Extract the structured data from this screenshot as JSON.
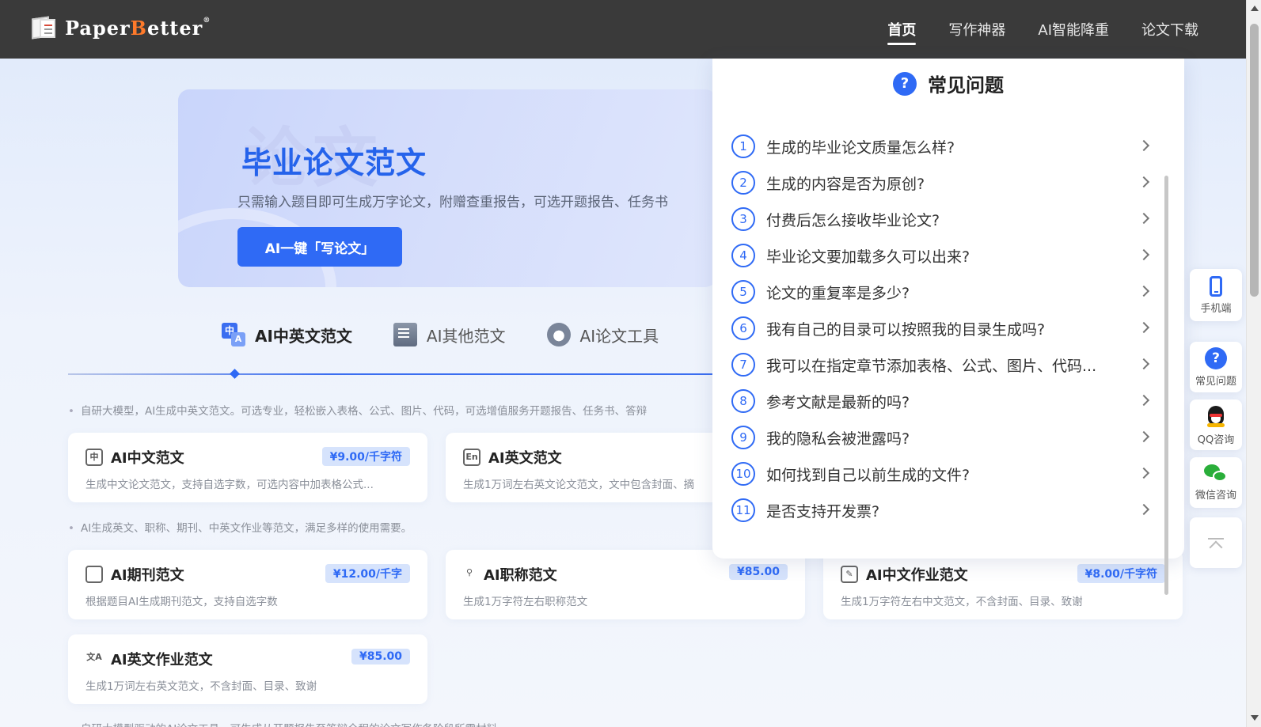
{
  "brand": {
    "logo_text_a": "Paper",
    "logo_text_b": "B",
    "logo_text_c": "etter",
    "logo_mark": "®"
  },
  "nav": [
    {
      "label": "首页",
      "active": true
    },
    {
      "label": "写作神器",
      "active": false
    },
    {
      "label": "AI智能降重",
      "active": false
    },
    {
      "label": "论文下载",
      "active": false
    }
  ],
  "banner": {
    "ghost_text": "论文",
    "title": "毕业论文范文",
    "subtitle": "只需输入题目即可生成万字论文，附赠查重报告，可选开题报告、任务书",
    "button": "AI一键「写论文」"
  },
  "tabs": [
    {
      "label": "AI中英文范文",
      "icon": "zh-en-icon",
      "active": true
    },
    {
      "label": "AI其他范文",
      "icon": "book-icon",
      "active": false
    },
    {
      "label": "AI论文工具",
      "icon": "gear-icon",
      "active": false
    }
  ],
  "notes": {
    "n1": "自研大模型，AI生成中英文范文。可选专业，轻松嵌入表格、公式、图片、代码，可选增值服务开题报告、任务书、答辩",
    "n2": "AI生成英文、职称、期刊、中英文作业等范文，满足多样的使用需要。",
    "n3": "自研大模型驱动的AI论文工具，可生成从开题报告至答辩全程的论文写作各阶段所需材料。"
  },
  "cards": {
    "zh": {
      "icon": "中",
      "title": "AI中文范文",
      "price": "¥9.00/千字符",
      "desc": "生成中文论文范文，支持自选字数，可选内容中加表格公式..."
    },
    "en": {
      "icon": "En",
      "title": "AI英文范文",
      "desc": "生成1万词左右英文论文范文，文中包含封面、摘"
    },
    "journal": {
      "icon": "journal-icon",
      "title": "AI期刊范文",
      "price": "¥12.00/千字",
      "desc": "根据题目AI生成期刊范文，支持自选字数"
    },
    "title_paper": {
      "icon": "tie-icon",
      "title": "AI职称范文",
      "price": "¥85.00",
      "desc": "生成1万字符左右职称范文"
    },
    "zh_hw": {
      "icon": "edit-doc-icon",
      "title": "AI中文作业范文",
      "price": "¥8.00/千字符",
      "desc": "生成1万字符左右中文范文，不含封面、目录、致谢"
    },
    "en_hw": {
      "icon": "translate-icon",
      "title": "AI英文作业范文",
      "price": "¥85.00",
      "desc": "生成1万词左右英文范文，不含封面、目录、致谢"
    }
  },
  "faq": {
    "title": "常见问题",
    "items": [
      {
        "num": "1",
        "q": "生成的毕业论文质量怎么样?"
      },
      {
        "num": "2",
        "q": "生成的内容是否为原创?"
      },
      {
        "num": "3",
        "q": "付费后怎么接收毕业论文?"
      },
      {
        "num": "4",
        "q": "毕业论文要加载多久可以出来?"
      },
      {
        "num": "5",
        "q": "论文的重复率是多少?"
      },
      {
        "num": "6",
        "q": "我有自己的目录可以按照我的目录生成吗?"
      },
      {
        "num": "7",
        "q": "我可以在指定章节添加表格、公式、图片、代码..."
      },
      {
        "num": "8",
        "q": "参考文献是最新的吗?"
      },
      {
        "num": "9",
        "q": "我的隐私会被泄露吗?"
      },
      {
        "num": "10",
        "q": "如何找到自己以前生成的文件?"
      },
      {
        "num": "11",
        "q": "是否支持开发票?"
      }
    ]
  },
  "side_tools": {
    "mobile": "手机端",
    "faq": "常见问题",
    "qq": "QQ咨询",
    "wechat": "微信咨询"
  },
  "colors": {
    "accent": "#2f6af5",
    "nav_bg": "#3a3a3a",
    "price_bg": "#d6e3fc"
  }
}
